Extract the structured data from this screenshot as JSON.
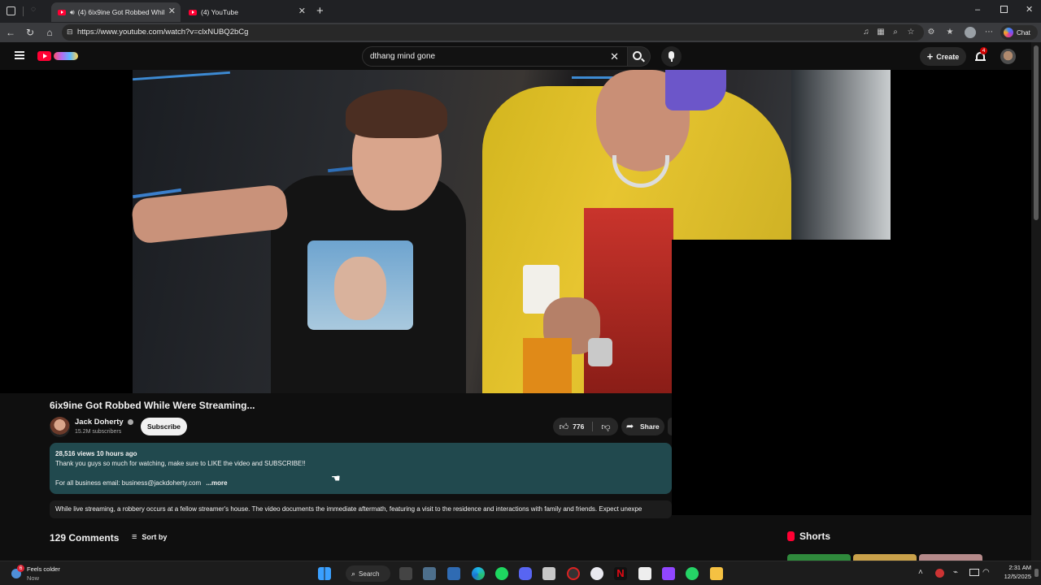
{
  "browser": {
    "tabs": [
      {
        "label": "(4) 6ix9ine Got Robbed Whil",
        "active": true
      },
      {
        "label": "(4) YouTube",
        "active": false
      }
    ],
    "url": "https://www.youtube.com/watch?v=clxNUBQ2bCg",
    "copilot_label": "Chat"
  },
  "youtube": {
    "search_value": "dthang mind gone",
    "create_label": "Create",
    "notification_count": "4"
  },
  "video": {
    "title": "6ix9ine Got Robbed While Were Streaming...",
    "channel": "Jack Doherty",
    "subscribers": "15.2M subscribers",
    "subscribe_label": "Subscribe",
    "likes": "776",
    "share_label": "Share",
    "description": {
      "meta": "28,516 views  10 hours ago",
      "line1": "Thank you guys so much for watching, make sure to LIKE the video and SUBSCRIBE!!",
      "line2": "For all business email: business@jackdoherty.com",
      "more": "...more"
    },
    "ai_summary": "While live streaming, a robbery occurs at a fellow streamer's house. The video documents the immediate aftermath, featuring a visit to the residence and interactions with family and friends. Expect unexpe"
  },
  "comments": {
    "count_label": "129 Comments",
    "sort_label": "Sort by"
  },
  "sidebar": {
    "shorts_label": "Shorts"
  },
  "taskbar": {
    "weather_title": "Feels colder",
    "weather_sub": "Now",
    "weather_badge": "6",
    "search_label": "Search",
    "time": "2:31 AM",
    "date": "12/5/2025"
  }
}
